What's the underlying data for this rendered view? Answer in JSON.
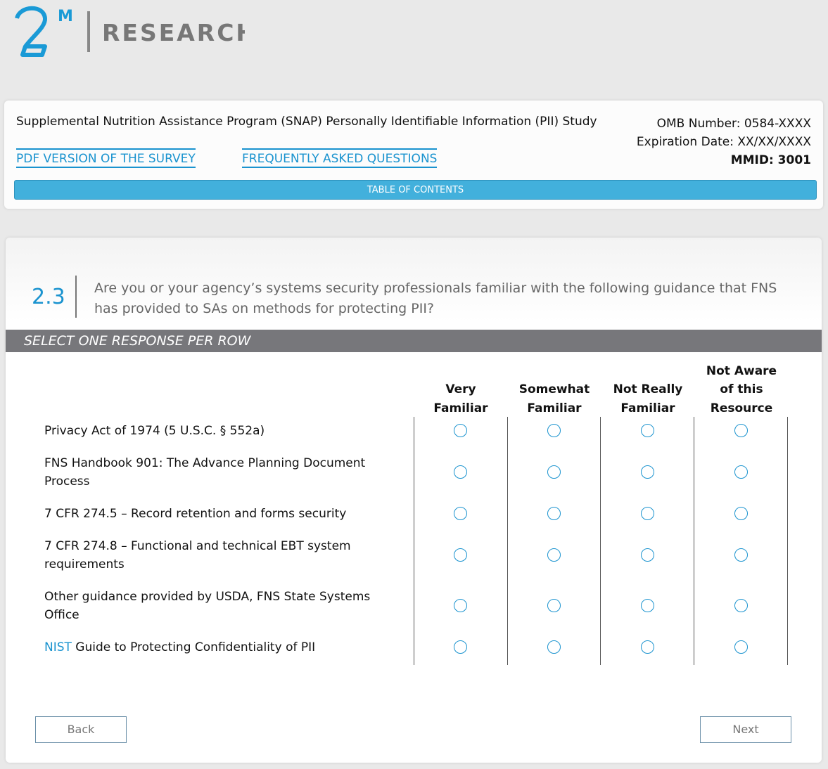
{
  "logo": {
    "mark": "2M",
    "text": "RESEARCH"
  },
  "header": {
    "study_title": "Supplemental Nutrition Assistance Program (SNAP) Personally Identifiable Information (PII) Study",
    "omb": "OMB Number: 0584-XXXX",
    "expiration": "Expiration Date: XX/XX/XXXX",
    "mmid": "MMID: 3001",
    "pdf_link": "PDF VERSION OF THE SURVEY",
    "faq_link": "FREQUENTLY ASKED QUESTIONS",
    "toc": "TABLE OF CONTENTS"
  },
  "question": {
    "number": "2.3",
    "text": "Are you or your agency’s systems security professionals familiar with the following guidance that FNS has provided to SAs on methods for protecting PII?",
    "instruction": "SELECT ONE RESPONSE PER ROW"
  },
  "columns": [
    [
      "Very",
      "Familiar"
    ],
    [
      "Somewhat",
      "Familiar"
    ],
    [
      "Not Really",
      "Familiar"
    ],
    [
      "Not Aware",
      "of this",
      "Resource"
    ]
  ],
  "rows": [
    {
      "label": "Privacy Act of 1974 (5 U.S.C. § 552a)"
    },
    {
      "label": "FNS Handbook 901: The Advance Planning Document Process"
    },
    {
      "label": "7 CFR 274.5 – Record retention and forms security"
    },
    {
      "label": "7 CFR 274.8 – Functional and technical EBT system requirements"
    },
    {
      "label": "Other guidance provided by USDA, FNS State Systems Office"
    },
    {
      "link": "NIST",
      "label": " Guide to Protecting Confidentiality of PII"
    }
  ],
  "nav": {
    "back": "Back",
    "next": "Next"
  }
}
